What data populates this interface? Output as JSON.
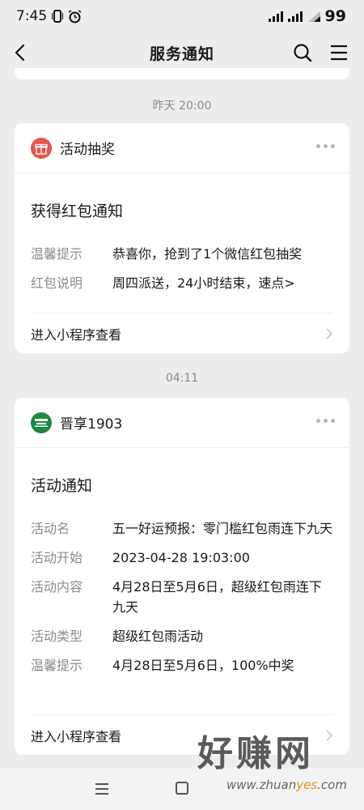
{
  "status_bar": {
    "time": "7:45",
    "battery": "99"
  },
  "nav": {
    "title": "服务通知"
  },
  "messages": [
    {
      "time": "昨天 20:00",
      "app_name": "活动抽奖",
      "title": "获得红包通知",
      "fields": [
        {
          "key": "温馨提示",
          "value": "恭喜你，抢到了1个微信红包抽奖"
        },
        {
          "key": "红包说明",
          "value": "周四派送，24小时结束，速点>"
        }
      ],
      "footer": "进入小程序查看"
    },
    {
      "time": "04:11",
      "app_name": "晋享1903",
      "title": "活动通知",
      "fields": [
        {
          "key": "活动名",
          "value": "五一好运预报：零门槛红包雨连下九天"
        },
        {
          "key": "活动开始",
          "value": "2023-04-28 19:03:00"
        },
        {
          "key": "活动内容",
          "value": "4月28日至5月6日，超级红包雨连下九天"
        },
        {
          "key": "活动类型",
          "value": "超级红包雨活动"
        },
        {
          "key": "温馨提示",
          "value": "4月28日至5月6日，100%中奖"
        }
      ],
      "footer": "进入小程序查看"
    }
  ],
  "watermark": {
    "text": "好赚网",
    "url_prefix": "www.zhuan",
    "url_highlight": "yes",
    "url_suffix": ".com"
  },
  "colors": {
    "lottery_logo": "#e8544a",
    "jinxiang_logo": "#1e8a3e",
    "background": "#ededed"
  }
}
